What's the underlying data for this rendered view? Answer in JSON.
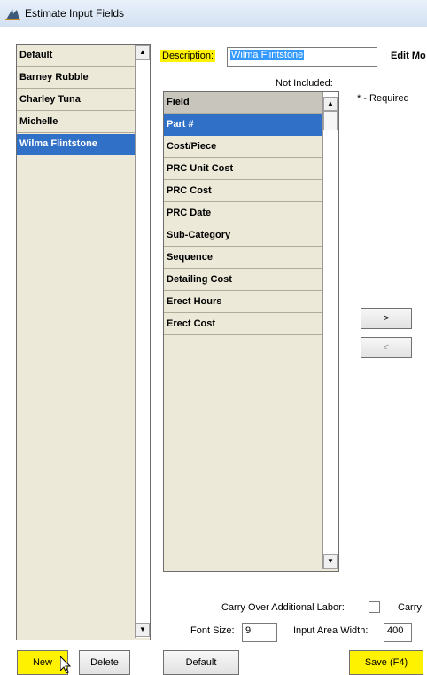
{
  "window": {
    "title": "Estimate Input Fields"
  },
  "profiles": {
    "items": [
      "Default",
      "Barney Rubble",
      "Charley Tuna",
      "Michelle",
      "Wilma Flintstone"
    ],
    "selected_index": 4
  },
  "description": {
    "label": "Description:",
    "value": "Wilma Flintstone"
  },
  "edit_mode_label": "Edit Mo",
  "not_included": {
    "caption": "Not Included:",
    "header": "Field",
    "items": [
      "Part #",
      "Cost/Piece",
      "PRC Unit Cost",
      "PRC Cost",
      "PRC Date",
      "Sub-Category",
      "Sequence",
      "Detailing Cost",
      "Erect Hours",
      "Erect Cost"
    ],
    "selected_index": 0
  },
  "required_note": "* - Required",
  "move_buttons": {
    "add": ">",
    "remove": "<"
  },
  "options": {
    "carry_over_label": "Carry Over Additional Labor:",
    "carry_over_checked": false,
    "carry_cut_label": "Carry",
    "font_size_label": "Font Size:",
    "font_size_value": "9",
    "input_area_width_label": "Input Area Width:",
    "input_area_width_value": "400"
  },
  "buttons": {
    "new": "New",
    "delete": "Delete",
    "default": "Default",
    "save": "Save (F4)"
  },
  "colors": {
    "panel_bg": "#ece9d8",
    "selection": "#3170c7",
    "highlight": "#fff200"
  }
}
